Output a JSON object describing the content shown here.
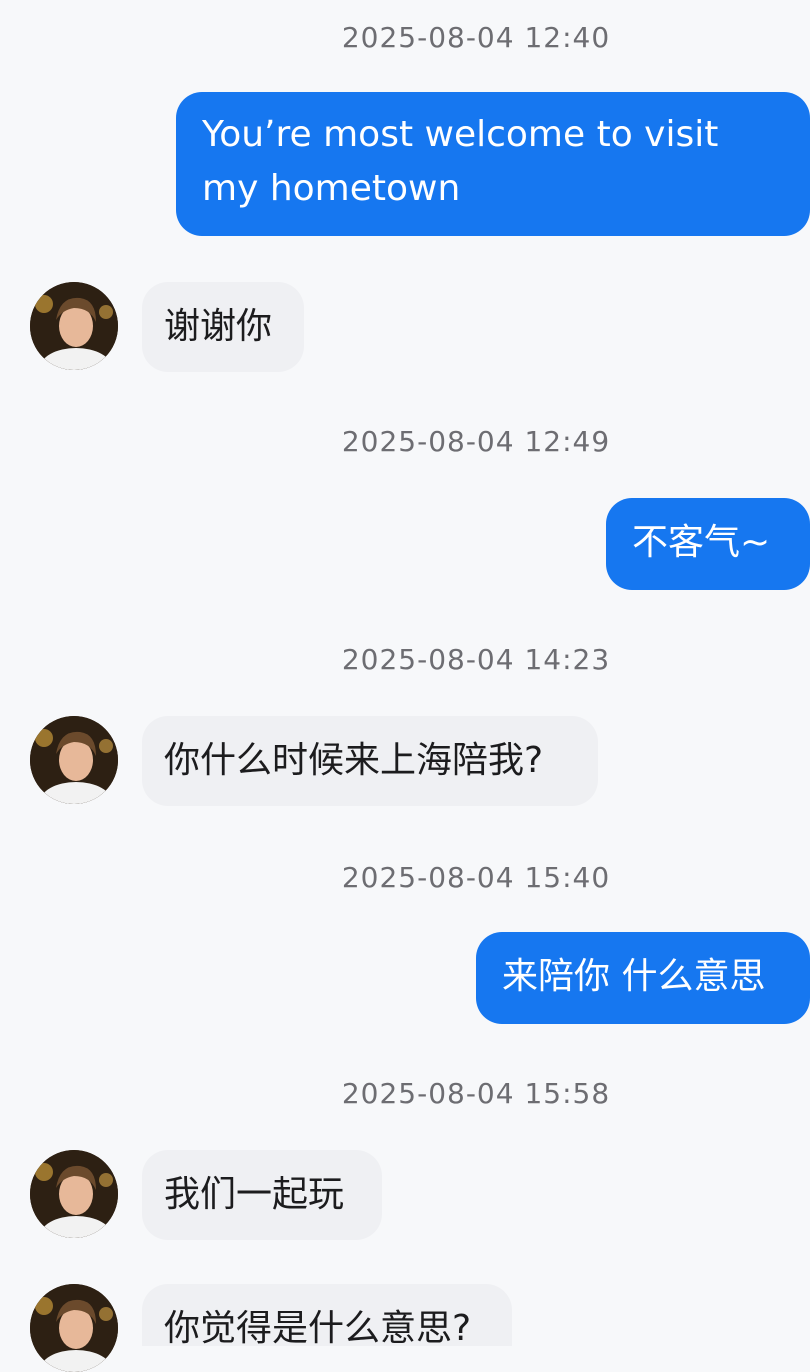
{
  "messages": [
    {
      "type": "timestamp",
      "text": "2025-08-04 12:40"
    },
    {
      "type": "outgoing",
      "text": "You’re most welcome to visit my hometown"
    },
    {
      "type": "incoming",
      "text": "谢谢你"
    },
    {
      "type": "timestamp",
      "text": "2025-08-04 12:49"
    },
    {
      "type": "outgoing",
      "text": "不客气~"
    },
    {
      "type": "timestamp",
      "text": "2025-08-04 14:23"
    },
    {
      "type": "incoming",
      "text": "你什么时候来上海陪我?"
    },
    {
      "type": "timestamp",
      "text": "2025-08-04 15:40"
    },
    {
      "type": "outgoing",
      "text": "来陪你 什么意思"
    },
    {
      "type": "timestamp",
      "text": "2025-08-04 15:58"
    },
    {
      "type": "incoming",
      "text": "我们一起玩"
    },
    {
      "type": "incoming",
      "text": "你觉得是什么意思?"
    }
  ],
  "colors": {
    "outgoing_bubble": "#1677f0",
    "incoming_bubble": "#eff0f3",
    "background": "#f7f8fa",
    "timestamp_text": "#6d6d72"
  }
}
